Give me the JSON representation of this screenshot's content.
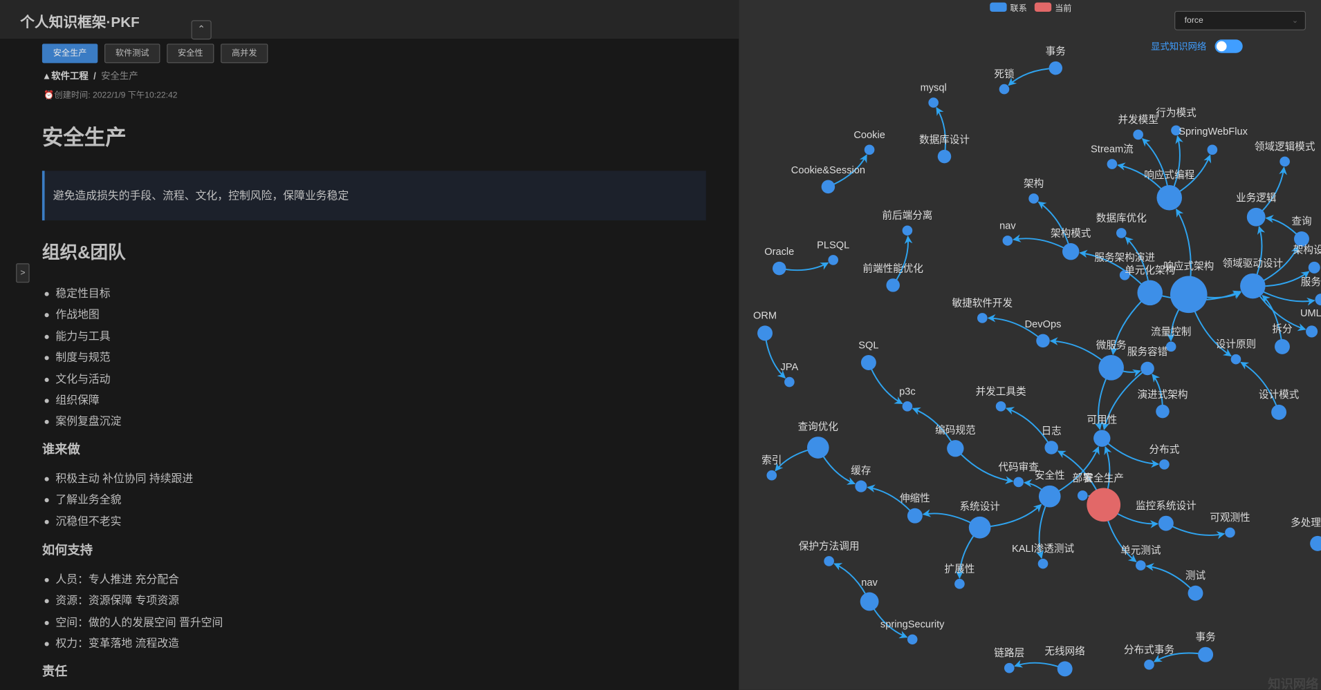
{
  "header": {
    "title": "个人知识框架·PKF",
    "collapse_icon": "chevron-up"
  },
  "tabs": [
    {
      "label": "安全生产",
      "active": true
    },
    {
      "label": "软件测试"
    },
    {
      "label": "安全性"
    },
    {
      "label": "高并发"
    }
  ],
  "breadcrumb": {
    "root": "软件工程",
    "separator": "/",
    "current": "安全生产"
  },
  "created": {
    "label": "创建时间: 2022/1/9 下午10:22:42"
  },
  "article": {
    "title": "安全生产",
    "quote": "避免造成损失的手段、流程、文化，控制风险，保障业务稳定",
    "sections": [
      {
        "heading": "组织&团队",
        "items": [
          "稳定性目标",
          "作战地图",
          "能力与工具",
          "制度与规范",
          "文化与活动",
          "组织保障",
          "案例复盘沉淀"
        ]
      },
      {
        "heading": "谁来做",
        "items": [
          "积极主动 补位协同 持续跟进",
          "了解业务全貌",
          "沉稳但不老实"
        ]
      },
      {
        "heading": "如何支持",
        "items": [
          "人员：专人推进 充分配合",
          "资源：资源保障 专项资源",
          "空间：做的人的发展空间 晋升空间",
          "权力：变革落地 流程改造"
        ]
      },
      {
        "heading": "责任",
        "items": []
      }
    ]
  },
  "graph": {
    "legend": [
      {
        "label": "联系",
        "color": "#3d8fe8"
      },
      {
        "label": "当前",
        "color": "#e26868"
      }
    ],
    "layout_select": "force",
    "toggle": {
      "label": "显式知识网络",
      "on": true
    },
    "watermark": "知识网络",
    "colors": {
      "node": "#3d8fe8",
      "current": "#e26868",
      "edge": "#2fa4f0",
      "label": "#dddddd"
    },
    "nodes": [
      {
        "id": "shiwu1",
        "label": "事务"
      },
      {
        "id": "sisuo",
        "label": "死锁"
      },
      {
        "id": "mysql",
        "label": "mysql"
      },
      {
        "id": "sjksj",
        "label": "数据库设计"
      },
      {
        "id": "cookie",
        "label": "Cookie"
      },
      {
        "id": "cs",
        "label": "Cookie&Session"
      },
      {
        "id": "bfmx",
        "label": "并发模型"
      },
      {
        "id": "xwms",
        "label": "行为模式"
      },
      {
        "id": "swf",
        "label": "SpringWebFlux"
      },
      {
        "id": "stream",
        "label": "Stream流"
      },
      {
        "id": "xysbc",
        "label": "响应式编程"
      },
      {
        "id": "lyljms",
        "label": "领域逻辑模式"
      },
      {
        "id": "jg",
        "label": "架构"
      },
      {
        "id": "ywlj",
        "label": "业务逻辑"
      },
      {
        "id": "sjkyh",
        "label": "数据库优化"
      },
      {
        "id": "cx",
        "label": "查询"
      },
      {
        "id": "nav1",
        "label": "nav"
      },
      {
        "id": "jgms",
        "label": "架构模式"
      },
      {
        "id": "qhdfl",
        "label": "前后端分离"
      },
      {
        "id": "plsql",
        "label": "PLSQL"
      },
      {
        "id": "oracle",
        "label": "Oracle"
      },
      {
        "id": "qdxnyh",
        "label": "前端性能优化"
      },
      {
        "id": "jgs",
        "label": "架构设"
      },
      {
        "id": "fwjgyj",
        "label": "服务架构演进"
      },
      {
        "id": "dyhjg",
        "label": "单元化架构"
      },
      {
        "id": "xysjg",
        "label": "响应式架构"
      },
      {
        "id": "lyqdsj",
        "label": "领域驱动设计"
      },
      {
        "id": "fw",
        "label": "服务"
      },
      {
        "id": "uml",
        "label": "UML"
      },
      {
        "id": "cf",
        "label": "拆分"
      },
      {
        "id": "mjrjkf",
        "label": "敏捷软件开发"
      },
      {
        "id": "devops",
        "label": "DevOps"
      },
      {
        "id": "orm",
        "label": "ORM"
      },
      {
        "id": "jpa",
        "label": "JPA"
      },
      {
        "id": "sql",
        "label": "SQL"
      },
      {
        "id": "p3c",
        "label": "p3c"
      },
      {
        "id": "wfw",
        "label": "微服务"
      },
      {
        "id": "llkz",
        "label": "流量控制"
      },
      {
        "id": "fwrc",
        "label": "服务容错"
      },
      {
        "id": "sjyz",
        "label": "设计原则"
      },
      {
        "id": "sjms",
        "label": "设计模式"
      },
      {
        "id": "yjsjg",
        "label": "演进式架构"
      },
      {
        "id": "bfgjl",
        "label": "并发工具类"
      },
      {
        "id": "rz",
        "label": "日志"
      },
      {
        "id": "kyx",
        "label": "可用性"
      },
      {
        "id": "fbs",
        "label": "分布式"
      },
      {
        "id": "bmgf",
        "label": "编码规范"
      },
      {
        "id": "cxyh",
        "label": "查询优化"
      },
      {
        "id": "sy",
        "label": "索引"
      },
      {
        "id": "hc",
        "label": "缓存"
      },
      {
        "id": "dmsc",
        "label": "代码审查"
      },
      {
        "id": "aqx",
        "label": "安全性"
      },
      {
        "id": "bs",
        "label": "部署"
      },
      {
        "id": "aqsc",
        "label": "安全生产",
        "current": true
      },
      {
        "id": "ssx",
        "label": "伸缩性"
      },
      {
        "id": "xtsj",
        "label": "系统设计"
      },
      {
        "id": "jkxtsj",
        "label": "监控系统设计"
      },
      {
        "id": "kgcx",
        "label": "可观测性"
      },
      {
        "id": "dcl",
        "label": "多处理"
      },
      {
        "id": "bhffdy",
        "label": "保护方法调用"
      },
      {
        "id": "kali",
        "label": "KALI渗透测试"
      },
      {
        "id": "dycs",
        "label": "单元测试"
      },
      {
        "id": "cs2",
        "label": "测试"
      },
      {
        "id": "kzx",
        "label": "扩展性"
      },
      {
        "id": "nav2",
        "label": "nav"
      },
      {
        "id": "ss",
        "label": "springSecurity"
      },
      {
        "id": "llc",
        "label": "链路层"
      },
      {
        "id": "wxwl",
        "label": "无线网络"
      },
      {
        "id": "fbsw",
        "label": "分布式事务"
      },
      {
        "id": "shiwu2",
        "label": "事务"
      }
    ],
    "edges": [
      [
        "shiwu1",
        "sisuo"
      ],
      [
        "sjksj",
        "mysql"
      ],
      [
        "cs",
        "cookie"
      ],
      [
        "xysbc",
        "bfmx"
      ],
      [
        "xysbc",
        "xwms"
      ],
      [
        "xysbc",
        "swf"
      ],
      [
        "xysbc",
        "stream"
      ],
      [
        "ywlj",
        "lyljms"
      ],
      [
        "cx",
        "ywlj"
      ],
      [
        "jgms",
        "jg"
      ],
      [
        "jgms",
        "nav1"
      ],
      [
        "oracle",
        "plsql"
      ],
      [
        "qdxnyh",
        "qhdfl"
      ],
      [
        "dyhjg",
        "sjkyh"
      ],
      [
        "dyhjg",
        "jgms"
      ],
      [
        "xysjg",
        "xysbc"
      ],
      [
        "xysjg",
        "lyqdsj"
      ],
      [
        "dyhjg",
        "lyqdsj"
      ],
      [
        "lyqdsj",
        "ywlj"
      ],
      [
        "lyqdsj",
        "cx"
      ],
      [
        "lyqdsj",
        "jgs"
      ],
      [
        "lyqdsj",
        "fw"
      ],
      [
        "lyqdsj",
        "uml"
      ],
      [
        "cf",
        "lyqdsj"
      ],
      [
        "xysjg",
        "sjyz"
      ],
      [
        "sjms",
        "sjyz"
      ],
      [
        "devops",
        "mjrjkf"
      ],
      [
        "orm",
        "jpa"
      ],
      [
        "sql",
        "p3c"
      ],
      [
        "wfw",
        "devops"
      ],
      [
        "dyhjg",
        "wfw"
      ],
      [
        "xysjg",
        "llkz"
      ],
      [
        "wfw",
        "fwrc"
      ],
      [
        "yjsjg",
        "fwrc"
      ],
      [
        "wfw",
        "kyx"
      ],
      [
        "fwrc",
        "kyx"
      ],
      [
        "kyx",
        "fbs"
      ],
      [
        "rz",
        "bfgjl"
      ],
      [
        "bmgf",
        "p3c"
      ],
      [
        "bmgf",
        "dmsc"
      ],
      [
        "cxyh",
        "sy"
      ],
      [
        "cxyh",
        "hc"
      ],
      [
        "aqx",
        "dmsc"
      ],
      [
        "aqx",
        "kyx"
      ],
      [
        "aqsc",
        "rz"
      ],
      [
        "aqsc",
        "kyx"
      ],
      [
        "aqsc",
        "bs"
      ],
      [
        "aqsc",
        "jkxtsj"
      ],
      [
        "aqsc",
        "dycs"
      ],
      [
        "ssx",
        "hc"
      ],
      [
        "xtsj",
        "ssx"
      ],
      [
        "xtsj",
        "aqx"
      ],
      [
        "xtsj",
        "kzx"
      ],
      [
        "jkxtsj",
        "kgcx"
      ],
      [
        "aqx",
        "kali"
      ],
      [
        "cs2",
        "dycs"
      ],
      [
        "nav2",
        "bhffdy"
      ],
      [
        "nav2",
        "ss"
      ],
      [
        "wxwl",
        "llc"
      ],
      [
        "shiwu2",
        "fbsw"
      ]
    ]
  }
}
